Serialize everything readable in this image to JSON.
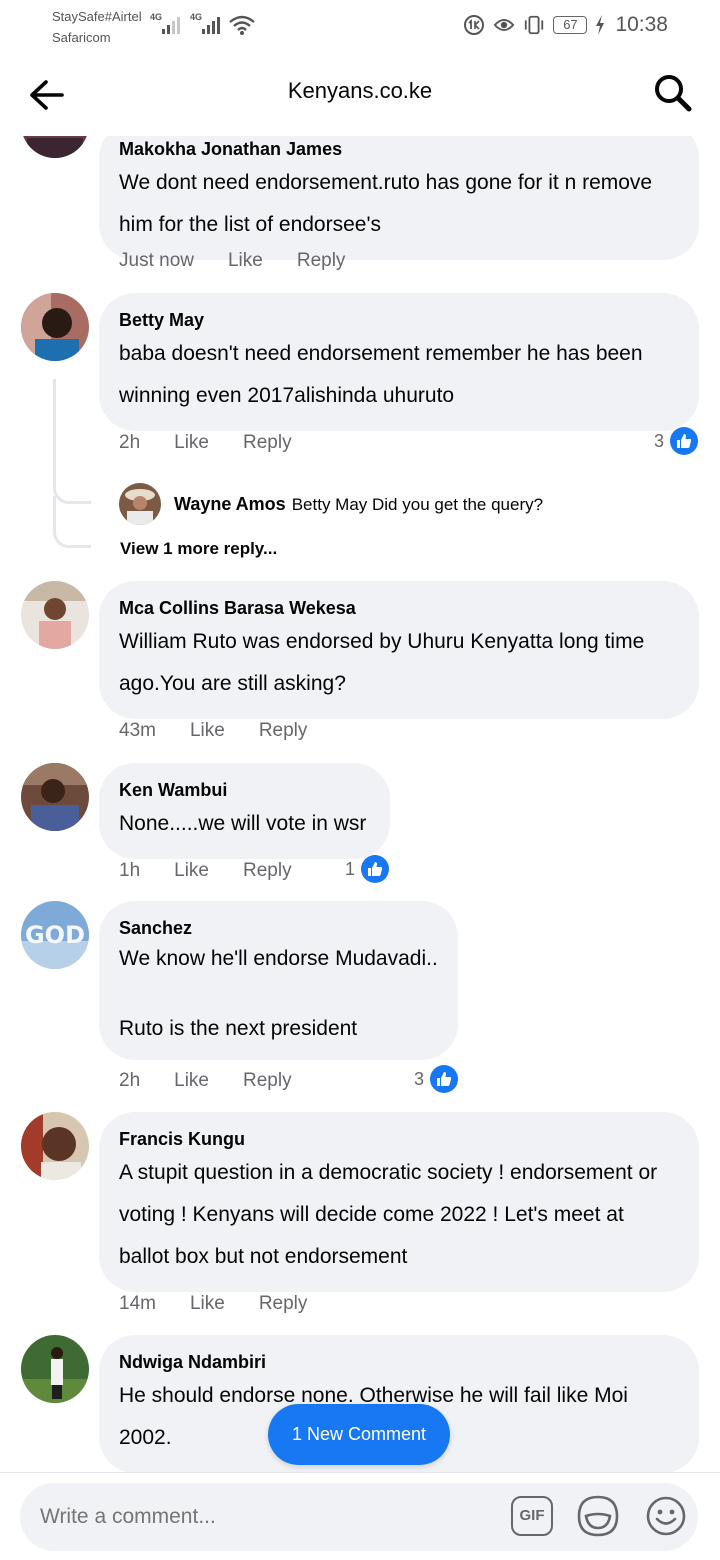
{
  "status_bar": {
    "carrier_line1": "StaySafe#Airtel",
    "carrier_line2": "Safaricom",
    "net1": "4G",
    "net2": "4G",
    "battery": "67",
    "time": "10:38"
  },
  "header": {
    "title": "Kenyans.co.ke",
    "back_icon": "arrow-left-icon",
    "search_icon": "search-icon"
  },
  "comments": [
    {
      "name": "Makokha Jonathan James",
      "text": "We dont need endorsement.ruto has gone for it n remove him for the list of endorsee's",
      "time": "Just now",
      "like": "Like",
      "reply": "Reply"
    },
    {
      "name": "Betty May",
      "text": "baba doesn't need endorsement remember he has been winning even 2017alishinda uhuruto",
      "time": "2h",
      "like": "Like",
      "reply": "Reply",
      "reactions": "3",
      "reply_preview": {
        "name": "Wayne Amos",
        "text": "Betty May Did you get the query?"
      },
      "more_replies": "View 1 more reply..."
    },
    {
      "name": "Mca Collins Barasa Wekesa",
      "text": "William Ruto was endorsed by Uhuru Kenyatta long time ago.You are still asking?",
      "time": "43m",
      "like": "Like",
      "reply": "Reply"
    },
    {
      "name": "Ken Wambui",
      "text": "None.....we will vote in wsr",
      "time": "1h",
      "like": "Like",
      "reply": "Reply",
      "reactions": "1"
    },
    {
      "name": "Sanchez",
      "text": "We know he'll endorse Mudavadi..\n\nRuto is the next president",
      "time": "2h",
      "like": "Like",
      "reply": "Reply",
      "reactions": "3"
    },
    {
      "name": "Francis Kungu",
      "text": "A stupit question in a democratic society ! endorsement or voting ! Kenyans will decide come 2022 ! Let's meet at ballot box but not endorsement",
      "time": "14m",
      "like": "Like",
      "reply": "Reply"
    },
    {
      "name": "Ndwiga Ndambiri",
      "text": "He should endorse none. Otherwise he will fail like Moi 2002."
    }
  ],
  "new_comment_pill": "1 New Comment",
  "composer": {
    "placeholder": "Write a comment...",
    "gif_label": "GIF",
    "sticker_icon": "sticker-icon",
    "emoji_icon": "smiley-icon"
  },
  "colors": {
    "accent": "#1877f2",
    "bubble": "#f0f2f5",
    "secondary_text": "#65676b"
  }
}
